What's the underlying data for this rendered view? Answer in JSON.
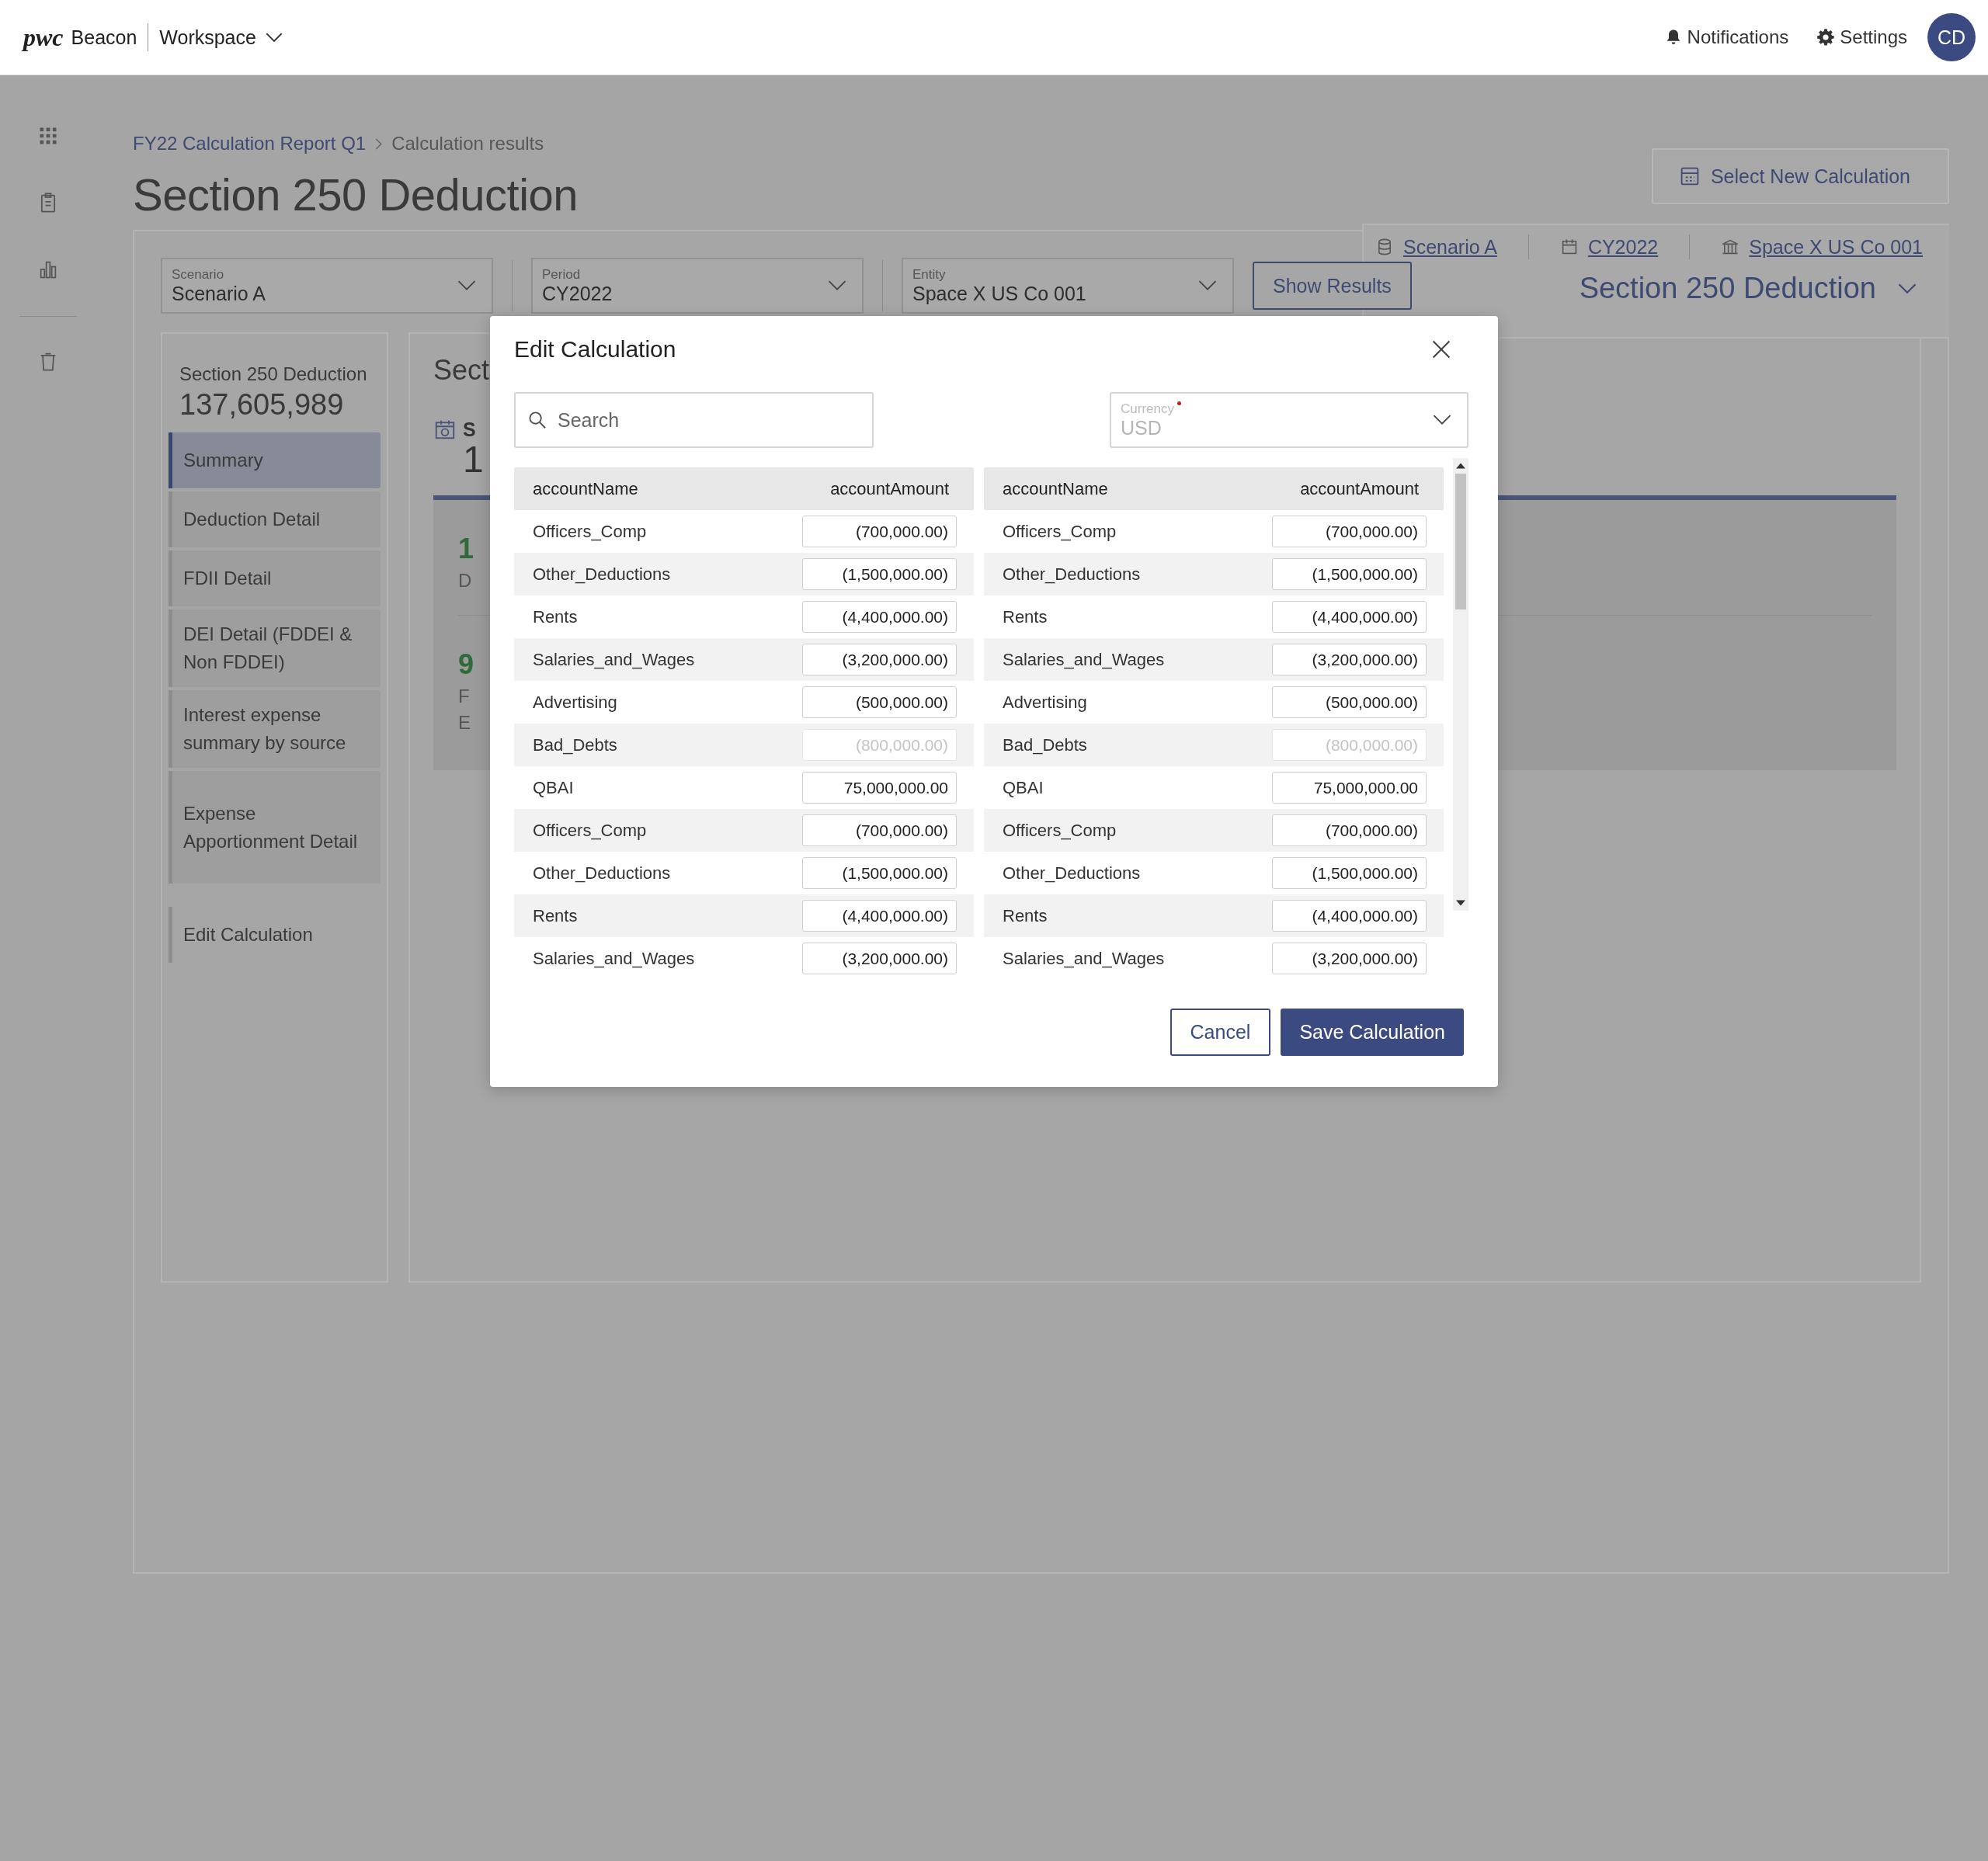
{
  "header": {
    "brand": "pwc",
    "product": "Beacon",
    "workspace": "Workspace",
    "notifications": "Notifications",
    "settings": "Settings",
    "avatar": "CD"
  },
  "breadcrumb": [
    {
      "label": "FY22 Calculation Report Q1",
      "kind": "link"
    },
    {
      "label": "Calculation results",
      "kind": "current"
    }
  ],
  "title": "Section 250 Deduction",
  "select_button": "Select New Calculation",
  "filters": [
    {
      "label": "Scenario",
      "value": "Scenario A"
    },
    {
      "label": "Period",
      "value": "CY2022"
    },
    {
      "label": "Entity",
      "value": "Space X US Co 001"
    }
  ],
  "show_results": "Show Results",
  "context": {
    "links": [
      {
        "kind": "scenario",
        "label": "Scenario A"
      },
      {
        "kind": "period",
        "label": "CY2022"
      },
      {
        "kind": "entity",
        "label": "Space X US Co 001"
      }
    ],
    "calculation": "Section 250 Deduction"
  },
  "nav": {
    "title": "Section 250 Deduction",
    "total": "137,605,989",
    "items": [
      {
        "label": "Summary",
        "selected": true
      },
      {
        "label": "Deduction Detail",
        "selected": false
      },
      {
        "label": "FDII Detail",
        "selected": false
      },
      {
        "label": "DEI Detail (FDDEI & Non FDDEI)",
        "selected": false
      },
      {
        "label": "Interest expense summary by source",
        "selected": false
      },
      {
        "label": "Expense Apportionment Detail",
        "selected": false
      }
    ],
    "extra": {
      "label": "Edit Calculation",
      "selected": false
    }
  },
  "summary_peek": {
    "heading": "Sect",
    "stat_label": "S",
    "stat_value": "1",
    "cards": [
      {
        "value": "1",
        "lines": [
          "D"
        ]
      },
      {
        "value": "9",
        "lines": [
          "F",
          "E"
        ]
      }
    ]
  },
  "modal": {
    "title": "Edit Calculation",
    "search": {
      "placeholder": "Search"
    },
    "currency": {
      "label": "Currency",
      "required": true,
      "value": "USD",
      "disabled": true
    },
    "tables": [
      {
        "columns": [
          "accountName",
          "accountAmount"
        ],
        "rows": [
          {
            "name": "Officers_Comp",
            "amount": "(700,000.00)",
            "disabled": false
          },
          {
            "name": "Other_Deductions",
            "amount": "(1,500,000.00)",
            "disabled": false
          },
          {
            "name": "Rents",
            "amount": "(4,400,000.00)",
            "disabled": false
          },
          {
            "name": "Salaries_and_Wages",
            "amount": "(3,200,000.00)",
            "disabled": false
          },
          {
            "name": "Advertising",
            "amount": "(500,000.00)",
            "disabled": false
          },
          {
            "name": "Bad_Debts",
            "amount": "(800,000.00)",
            "disabled": true
          },
          {
            "name": "QBAI",
            "amount": "75,000,000.00",
            "disabled": false
          },
          {
            "name": "Officers_Comp",
            "amount": "(700,000.00)",
            "disabled": false
          },
          {
            "name": "Other_Deductions",
            "amount": "(1,500,000.00)",
            "disabled": false
          },
          {
            "name": "Rents",
            "amount": "(4,400,000.00)",
            "disabled": false
          },
          {
            "name": "Salaries_and_Wages",
            "amount": "(3,200,000.00)",
            "disabled": false
          }
        ]
      },
      {
        "columns": [
          "accountName",
          "accountAmount"
        ],
        "rows": [
          {
            "name": "Officers_Comp",
            "amount": "(700,000.00)",
            "disabled": false
          },
          {
            "name": "Other_Deductions",
            "amount": "(1,500,000.00)",
            "disabled": false
          },
          {
            "name": "Rents",
            "amount": "(4,400,000.00)",
            "disabled": false
          },
          {
            "name": "Salaries_and_Wages",
            "amount": "(3,200,000.00)",
            "disabled": false
          },
          {
            "name": "Advertising",
            "amount": "(500,000.00)",
            "disabled": false
          },
          {
            "name": "Bad_Debts",
            "amount": "(800,000.00)",
            "disabled": true
          },
          {
            "name": "QBAI",
            "amount": "75,000,000.00",
            "disabled": false
          },
          {
            "name": "Officers_Comp",
            "amount": "(700,000.00)",
            "disabled": false
          },
          {
            "name": "Other_Deductions",
            "amount": "(1,500,000.00)",
            "disabled": false
          },
          {
            "name": "Rents",
            "amount": "(4,400,000.00)",
            "disabled": false
          },
          {
            "name": "Salaries_and_Wages",
            "amount": "(3,200,000.00)",
            "disabled": false
          }
        ]
      }
    ],
    "buttons": [
      {
        "label": "Cancel",
        "kind": "secondary"
      },
      {
        "label": "Save Calculation",
        "kind": "primary"
      }
    ]
  }
}
